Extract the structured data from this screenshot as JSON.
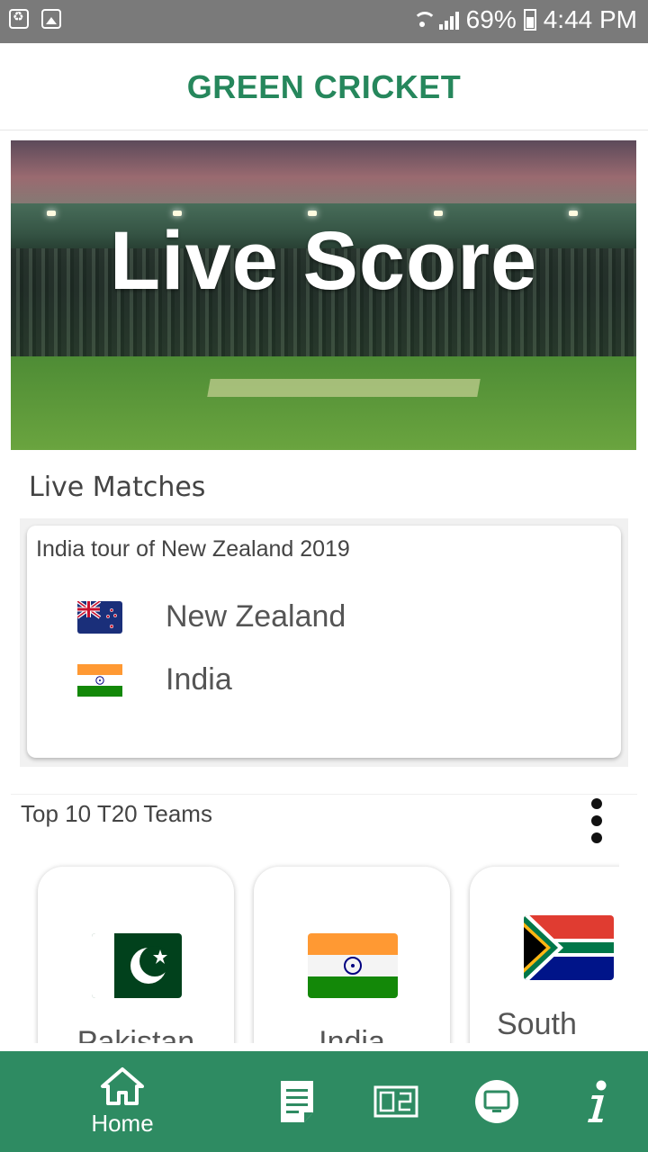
{
  "status_bar": {
    "battery_percent": "69%",
    "time": "4:44 PM"
  },
  "app": {
    "title": "GREEN CRICKET"
  },
  "hero": {
    "title": "Live Score"
  },
  "live_matches": {
    "heading": "Live Matches",
    "matches": [
      {
        "series": "India tour of New Zealand 2019",
        "teams": [
          {
            "name": "New Zealand",
            "flag_icon": "new-zealand-flag-icon"
          },
          {
            "name": "India",
            "flag_icon": "india-flag-icon"
          }
        ]
      }
    ]
  },
  "top_teams": {
    "heading": "Top 10 T20 Teams",
    "teams": [
      {
        "name": "Pakistan",
        "flag_icon": "pakistan-flag-icon"
      },
      {
        "name": "India",
        "flag_icon": "india-flag-icon"
      },
      {
        "name": "South",
        "flag_icon": "south-africa-flag-icon"
      }
    ]
  },
  "bottom_nav": {
    "items": [
      {
        "label": "Home",
        "icon": "home-icon",
        "active": true
      },
      {
        "label": "",
        "icon": "news-icon"
      },
      {
        "label": "",
        "icon": "scoreboard-icon"
      },
      {
        "label": "",
        "icon": "tv-icon"
      },
      {
        "label": "",
        "icon": "info-icon"
      }
    ]
  },
  "colors": {
    "brand_green": "#26875c",
    "nav_green": "#2e8b62",
    "status_bar": "#7a7a7a"
  }
}
